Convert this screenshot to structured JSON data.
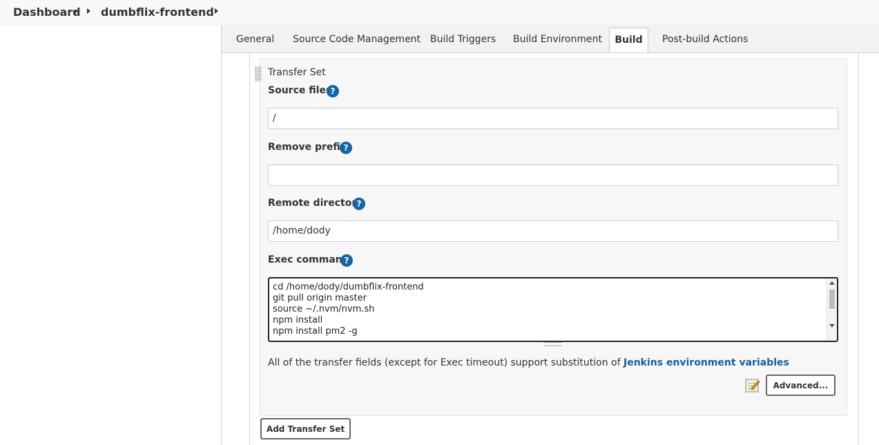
{
  "breadcrumb": {
    "items": [
      "Dashboard",
      "dumbflix-frontend"
    ]
  },
  "tabs": [
    {
      "label": "General"
    },
    {
      "label": "Source Code Management"
    },
    {
      "label": "Build Triggers"
    },
    {
      "label": "Build Environment"
    },
    {
      "label": "Build",
      "active": true
    },
    {
      "label": "Post-build Actions"
    }
  ],
  "transfer_set": {
    "title": "Transfer Set",
    "source_files": {
      "label": "Source files",
      "value": "/"
    },
    "remove_prefix": {
      "label": "Remove prefix",
      "value": ""
    },
    "remote_directory": {
      "label": "Remote directory",
      "value": "/home/dody"
    },
    "exec_command": {
      "label": "Exec command",
      "lines": [
        "cd /home/dody/dumbflix-frontend",
        "git pull origin master",
        "source ~/.nvm/nvm.sh",
        "npm install",
        "npm install pm2 -g"
      ]
    },
    "info_text": "All of the transfer fields (except for Exec timeout) support substitution of ",
    "info_link": "Jenkins environment variables",
    "advanced_button": "Advanced...",
    "help_glyph": "?"
  },
  "add_transfer_set_button": "Add Transfer Set",
  "colors": {
    "help_icon": "#1565a6",
    "link": "#1a5b9a"
  }
}
